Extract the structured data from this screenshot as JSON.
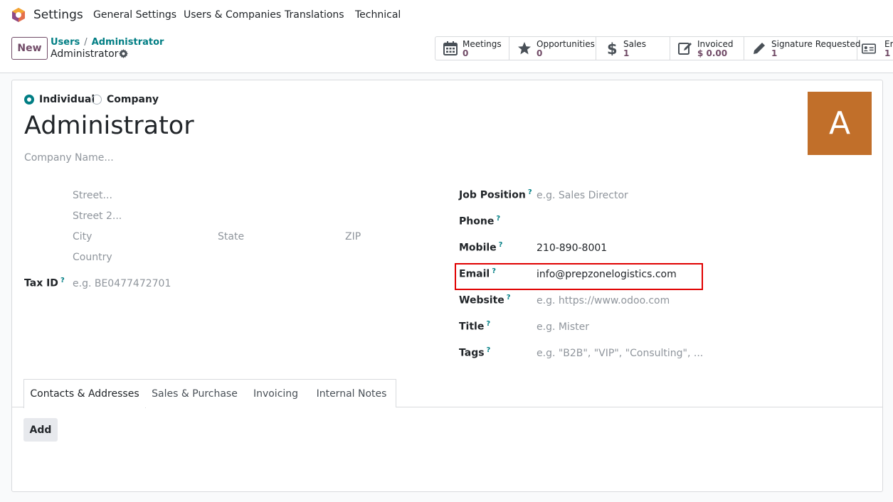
{
  "navbar": {
    "app_name": "Settings",
    "items": [
      "General Settings",
      "Users & Companies",
      "Translations",
      "Technical"
    ]
  },
  "control": {
    "new_label": "New",
    "breadcrumb_parent": "Users",
    "breadcrumb_sep": "/",
    "breadcrumb_middle": "Administrator",
    "breadcrumb_current": "Administrator"
  },
  "stats": [
    {
      "label": "Meetings",
      "value": "0",
      "icon": "calendar-icon"
    },
    {
      "label": "Opportunities",
      "value": "0",
      "icon": "star-icon"
    },
    {
      "label": "Sales",
      "value": "1",
      "icon": "dollar-icon"
    },
    {
      "label": "Invoiced",
      "value": "$ 0.00",
      "icon": "invoice-icon"
    },
    {
      "label": "Signature Requested",
      "value": "1",
      "icon": "pen-icon"
    },
    {
      "label": "Em",
      "value": "1",
      "icon": "id-card-icon"
    }
  ],
  "form": {
    "type_individual": "Individual",
    "type_company": "Company",
    "name": "Administrator",
    "company_placeholder": "Company Name...",
    "avatar_letter": "A",
    "address": {
      "street": "Street...",
      "street2": "Street 2...",
      "city": "City",
      "state": "State",
      "zip": "ZIP",
      "country": "Country"
    },
    "tax_id_label": "Tax ID",
    "tax_id_placeholder": "e.g. BE0477472701",
    "help_mark": "?",
    "job_position_label": "Job Position",
    "job_position_placeholder": "e.g. Sales Director",
    "phone_label": "Phone",
    "mobile_label": "Mobile",
    "mobile_value": "210-890-8001",
    "email_label": "Email",
    "email_value": "info@prepzonelogistics.com",
    "website_label": "Website",
    "website_placeholder": "e.g. https://www.odoo.com",
    "title_label": "Title",
    "title_placeholder": "e.g. Mister",
    "tags_label": "Tags",
    "tags_placeholder": "e.g. \"B2B\", \"VIP\", \"Consulting\", ..."
  },
  "tabs": [
    "Contacts & Addresses",
    "Sales & Purchase",
    "Invoicing",
    "Internal Notes"
  ],
  "add_label": "Add",
  "colors": {
    "brand": "#714b67",
    "link": "#017e84",
    "avatar": "#c16f2a",
    "highlight": "#e00000"
  }
}
